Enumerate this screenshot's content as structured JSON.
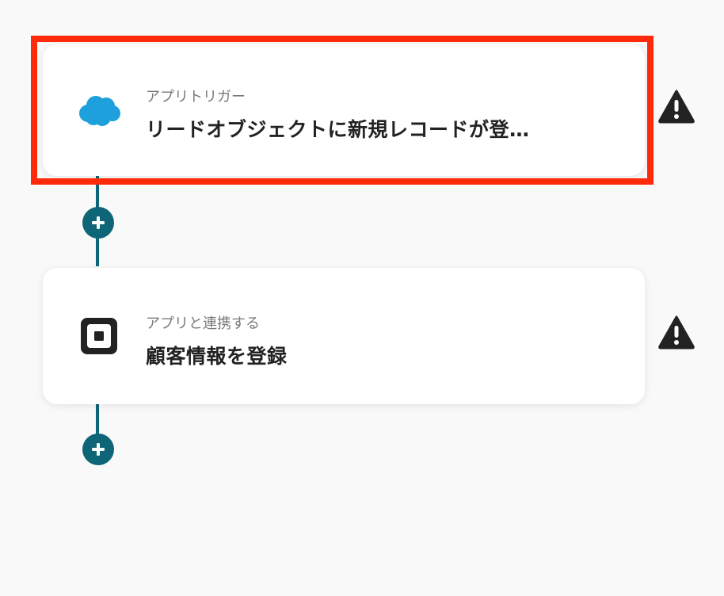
{
  "colors": {
    "accent": "#0e6578",
    "highlight": "#ff2a0a",
    "salesforce": "#1ea0dc",
    "warning": "#222222"
  },
  "flow": {
    "steps": [
      {
        "label": "アプリトリガー",
        "title": "リードオブジェクトに新規レコードが登…",
        "icon": "salesforce-cloud-icon",
        "status_icon": "warning-icon"
      },
      {
        "label": "アプリと連携する",
        "title": "顧客情報を登録",
        "icon": "square-app-icon",
        "status_icon": "warning-icon"
      }
    ],
    "add_step_icon": "plus-icon"
  }
}
